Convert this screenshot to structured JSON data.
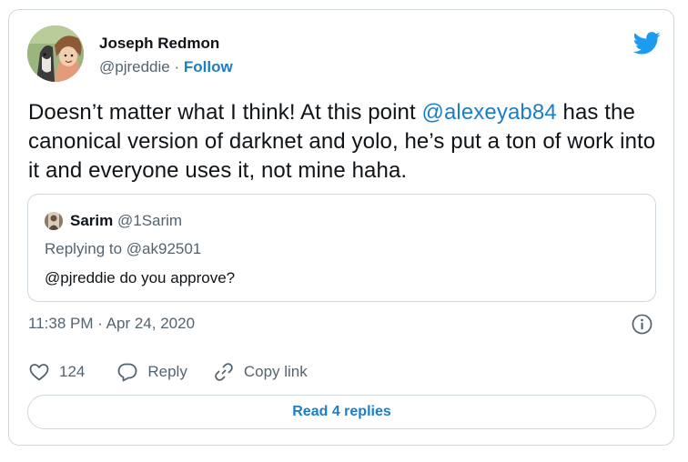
{
  "tweet": {
    "author_name": "Joseph Redmon",
    "author_handle": "@pjreddie",
    "separator": " · ",
    "follow_label": "Follow",
    "text_part1": "Doesn’t matter what I think! At this point ",
    "mention": "@alexeyab84",
    "text_part2": " has the canonical version of darknet and yolo, he’s put a ton of work into it and everyone uses it, not mine haha.",
    "timestamp": "11:38 PM · Apr 24, 2020"
  },
  "quoted_tweet": {
    "author_name": "Sarim",
    "author_handle": "@1Sarim",
    "reply_to": "Replying to @ak92501",
    "text": "@pjreddie do you approve?"
  },
  "actions": {
    "like_count": "124",
    "reply_label": "Reply",
    "copy_link_label": "Copy link"
  },
  "read_replies_label": "Read 4 replies",
  "icons": {
    "brand": "twitter-bird-icon",
    "info": "info-icon",
    "like": "heart-icon",
    "reply": "speech-bubble-icon",
    "copy": "link-icon"
  },
  "colors": {
    "accent": "#1b7fc8",
    "twitter_blue": "#1d9bf0",
    "secondary_text": "#536471",
    "border": "#cfd9de"
  }
}
